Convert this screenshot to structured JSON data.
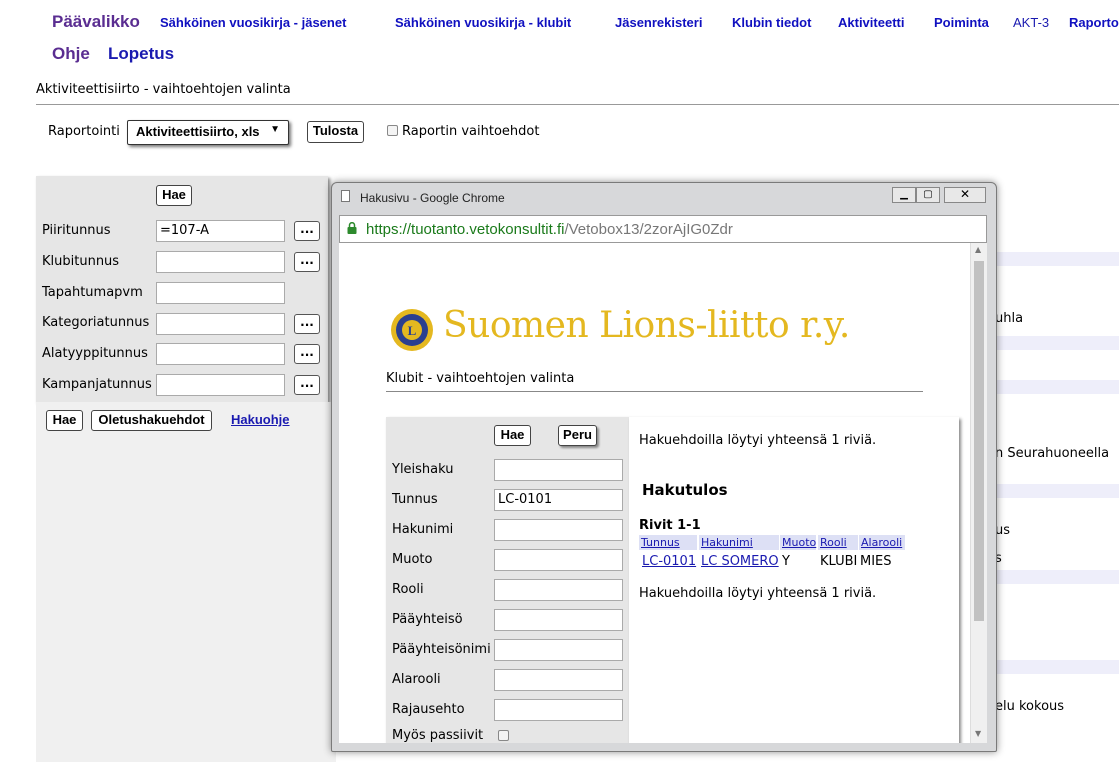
{
  "nav": {
    "items": [
      "Päävalikko",
      "Sähköinen vuosikirja - jäsenet",
      "Sähköinen vuosikirja - klubit",
      "Jäsenrekisteri",
      "Klubin tiedot",
      "Aktiviteetti",
      "Poiminta",
      "AKT-3",
      "Raportoi"
    ],
    "row2": [
      "Ohje",
      "Lopetus"
    ]
  },
  "page": {
    "title": "Aktiviteettisiirto - vaihtoehtojen valinta"
  },
  "report": {
    "label": "Raportointi",
    "selected": "Aktiviteettisiirto, xls",
    "print_button": "Tulosta",
    "options_label": "Raportin vaihtoehdot"
  },
  "filters": {
    "hae_top": "Hae",
    "fields": [
      {
        "label": "Piiritunnus",
        "value": "=107-A",
        "lookup": "..."
      },
      {
        "label": "Klubitunnus",
        "value": "",
        "lookup": "..."
      },
      {
        "label": "Tapahtumapvm",
        "value": ""
      },
      {
        "label": "Kategoriatunnus",
        "value": "",
        "lookup": "..."
      },
      {
        "label": "Alatyyppitunnus",
        "value": "",
        "lookup": "..."
      },
      {
        "label": "Kampanjatunnus",
        "value": "",
        "lookup": "..."
      }
    ],
    "hae_bottom": "Hae",
    "defaults_button": "Oletushakuehdot",
    "help_link": "Hakuohje"
  },
  "background_right": [
    "uhla",
    "n Seurahuoneella",
    "us",
    "s",
    "elu kokous"
  ],
  "popup": {
    "window_title": "Hakusivu - Google Chrome",
    "url_host": "https://tuotanto.vetokonsultit.fi",
    "url_path": "/Vetobox13/2zorAjIG0Zdr",
    "brand": "Suomen Lions-liitto r.y.",
    "subtitle": "Klubit - vaihtoehtojen valinta",
    "search": {
      "hae": "Hae",
      "peru": "Peru",
      "fields": [
        {
          "label": "Yleishaku",
          "value": ""
        },
        {
          "label": "Tunnus",
          "value": "LC-0101"
        },
        {
          "label": "Hakunimi",
          "value": ""
        },
        {
          "label": "Muoto",
          "value": ""
        },
        {
          "label": "Rooli",
          "value": ""
        },
        {
          "label": "Pääyhteisö",
          "value": ""
        },
        {
          "label": "Pääyhteisönimi",
          "value": ""
        },
        {
          "label": "Alarooli",
          "value": ""
        },
        {
          "label": "Rajausehto",
          "value": ""
        }
      ],
      "passive_label": "Myös passiivit"
    },
    "results": {
      "summary": "Hakuehdoilla löytyi yhteensä 1 riviä.",
      "heading": "Hakutulos",
      "rows_label": "Rivit 1-1",
      "columns": [
        "Tunnus",
        "Hakunimi",
        "Muoto",
        "Rooli",
        "Alarooli"
      ],
      "rows": [
        {
          "tunnus": "LC-0101",
          "hakunimi": "LC SOMERO",
          "muoto": "Y",
          "rooli": "KLUBI",
          "alarooli": "MIES"
        }
      ],
      "summary_bottom": "Hakuehdoilla löytyi yhteensä 1 riviä."
    }
  },
  "colors": {
    "nav_primary": "#5a2d91",
    "nav_link": "#1010c0",
    "brand_gold": "#e4b820",
    "url_green": "#1a7a1a"
  }
}
